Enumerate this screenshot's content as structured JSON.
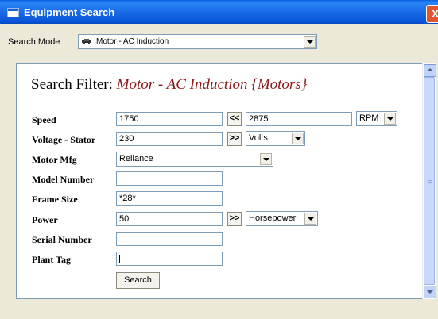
{
  "window": {
    "title": "Equipment Search",
    "close_glyph": "X"
  },
  "search_mode": {
    "label": "Search Mode",
    "value": "Motor - AC Induction",
    "icon": "car-icon"
  },
  "filter": {
    "heading": "Search Filter:",
    "subject": "Motor - AC Induction {Motors}"
  },
  "fields": {
    "speed": {
      "label": "Speed",
      "from": "1750",
      "button": "<<",
      "to": "2875",
      "unit": "RPM"
    },
    "voltage": {
      "label": "Voltage - Stator",
      "value": "230",
      "button": ">>",
      "unit": "Volts"
    },
    "motor_mfg": {
      "label": "Motor Mfg",
      "value": "Reliance"
    },
    "model_number": {
      "label": "Model Number",
      "value": ""
    },
    "frame_size": {
      "label": "Frame Size",
      "value": "*28*"
    },
    "power": {
      "label": "Power",
      "value": "50",
      "button": ">>",
      "unit": "Horsepower"
    },
    "serial_number": {
      "label": "Serial Number",
      "value": ""
    },
    "plant_tag": {
      "label": "Plant Tag",
      "value": ""
    }
  },
  "search_button": "Search"
}
